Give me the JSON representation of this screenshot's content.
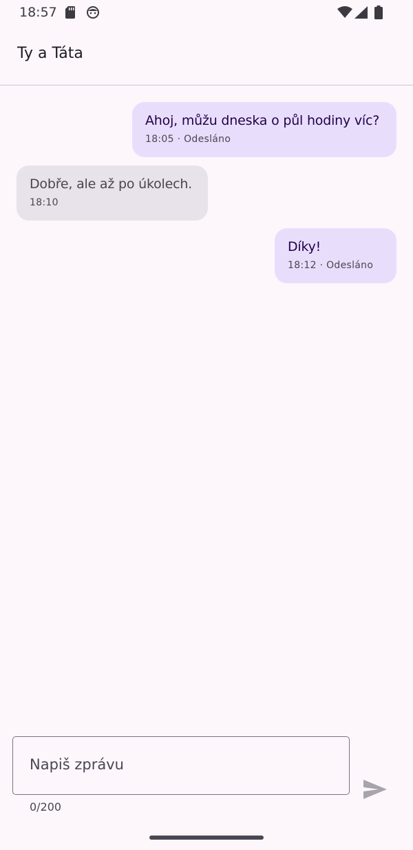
{
  "status_bar": {
    "time": "18:57",
    "icons": [
      "sd-card-icon",
      "face-icon",
      "wifi-icon",
      "signal-icon",
      "battery-icon"
    ]
  },
  "app_bar": {
    "title": "Ty a Táta"
  },
  "messages": [
    {
      "direction": "sent",
      "text": "Ahoj, můžu dneska o půl hodiny víc?",
      "meta": "18:05 · Odesláno"
    },
    {
      "direction": "received",
      "text": "Dobře, ale až po úkolech.",
      "meta": "18:10"
    },
    {
      "direction": "sent",
      "text": "Díky!",
      "meta": "18:12 · Odesláno"
    }
  ],
  "composer": {
    "placeholder": "Napiš zprávu",
    "value": "",
    "counter": "0/200",
    "send_icon": "send-icon"
  },
  "colors": {
    "background": "#fdf7fc",
    "sent_bubble": "#e8defc",
    "received_bubble": "#e8e3ea",
    "sent_text": "#22004a",
    "received_text": "#49454f"
  }
}
